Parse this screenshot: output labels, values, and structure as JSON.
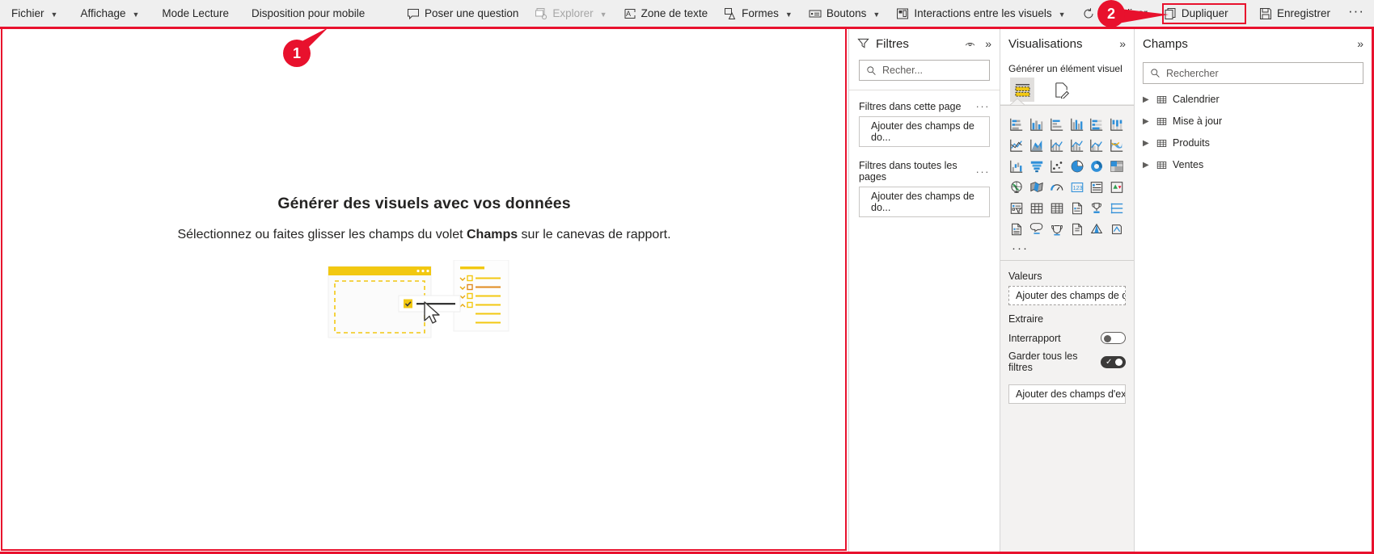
{
  "toolbar": {
    "left_items": [
      {
        "label": "Fichier",
        "icon": "chevron-down-icon",
        "has_chevron": true
      },
      {
        "label": "Affichage",
        "icon": "chevron-down-icon",
        "has_chevron": true
      },
      {
        "label": "Mode Lecture",
        "has_chevron": false
      },
      {
        "label": "Disposition pour mobile",
        "has_chevron": false
      }
    ],
    "right_items": [
      {
        "label": "Poser une question",
        "icon": "comment-icon",
        "has_chevron": false,
        "dim": false
      },
      {
        "label": "Explorer",
        "icon": "explore-icon",
        "has_chevron": true,
        "dim": true
      },
      {
        "label": "Zone de texte",
        "icon": "textbox-icon",
        "has_chevron": false,
        "dim": false
      },
      {
        "label": "Formes",
        "icon": "shapes-icon",
        "has_chevron": true,
        "dim": false
      },
      {
        "label": "Boutons",
        "icon": "button-icon",
        "has_chevron": true,
        "dim": false
      },
      {
        "label": "Interactions entre les visuels",
        "icon": "interactions-icon",
        "has_chevron": true,
        "dim": false
      },
      {
        "label": "Actualiser",
        "icon": "refresh-icon",
        "has_chevron": false,
        "dim": false
      },
      {
        "label": "Dupliquer",
        "icon": "duplicate-icon",
        "has_chevron": false,
        "dim": false
      },
      {
        "label": "Enregistrer",
        "icon": "save-icon",
        "has_chevron": false,
        "dim": false
      }
    ],
    "overflow_label": "···"
  },
  "annotations": {
    "marker_1": "1",
    "marker_2": "2",
    "accent_color": "#e8112d"
  },
  "canvas": {
    "title": "Générer des visuels avec vos données",
    "subtitle_before": "Sélectionnez ou faites glisser les champs du volet ",
    "subtitle_bold": "Champs",
    "subtitle_after": " sur le canevas de rapport."
  },
  "filters_panel": {
    "title": "Filtres",
    "filter_icon": "funnel-icon",
    "eye_icon": "eye-icon",
    "collapse_icon": "chevron-double-right-icon",
    "search_placeholder": "Recher...",
    "sections": [
      {
        "label": "Filtres dans cette page",
        "dots": "···",
        "drop_label": "Ajouter des champs de do..."
      },
      {
        "label": "Filtres dans toutes les pages",
        "dots": "···",
        "drop_label": "Ajouter des champs de do..."
      }
    ]
  },
  "visualizations_panel": {
    "title": "Visualisations",
    "collapse_icon": "chevron-double-right-icon",
    "subtitle": "Générer un élément visuel",
    "modes": [
      {
        "name": "build-visual-icon",
        "active": true
      },
      {
        "name": "format-visual-icon",
        "active": false
      }
    ],
    "chart_icons": [
      "stacked-bar-chart-icon",
      "stacked-column-chart-icon",
      "clustered-bar-chart-icon",
      "clustered-column-chart-icon",
      "100-stacked-bar-chart-icon",
      "100-stacked-column-chart-icon",
      "line-chart-icon",
      "area-chart-icon",
      "stacked-area-chart-icon",
      "line-stacked-column-icon",
      "line-clustered-column-icon",
      "ribbon-chart-icon",
      "waterfall-chart-icon",
      "funnel-chart-icon",
      "scatter-chart-icon",
      "pie-chart-icon",
      "donut-chart-icon",
      "treemap-icon",
      "map-icon",
      "filled-map-icon",
      "gauge-icon",
      "card-icon",
      "multi-row-card-icon",
      "kpi-icon",
      "slicer-icon",
      "table-icon",
      "matrix-icon",
      "r-script-visual-icon",
      "key-influencers-icon",
      "decomposition-tree-icon",
      "paginated-report-icon",
      "narrative-icon",
      "metrics-icon",
      "powerapps-icon",
      "azure-map-icon",
      "python-visual-icon"
    ],
    "more_label": "···",
    "values_label": "Valeurs",
    "values_drop": "Ajouter des champs de don...",
    "drill_label": "Extraire",
    "toggles": [
      {
        "label": "Interrapport",
        "on": false
      },
      {
        "label": "Garder tous les filtres",
        "on": true
      }
    ],
    "drill_drop": "Ajouter des champs d'extr..."
  },
  "fields_panel": {
    "title": "Champs",
    "collapse_icon": "chevron-double-right-icon",
    "search_placeholder": "Rechercher",
    "tables": [
      {
        "label": "Calendrier",
        "icon": "table-icon",
        "expander": "chevron-right-icon"
      },
      {
        "label": "Mise à jour",
        "icon": "table-icon",
        "expander": "chevron-right-icon"
      },
      {
        "label": "Produits",
        "icon": "table-icon",
        "expander": "chevron-right-icon"
      },
      {
        "label": "Ventes",
        "icon": "table-icon",
        "expander": "chevron-right-icon"
      }
    ]
  }
}
